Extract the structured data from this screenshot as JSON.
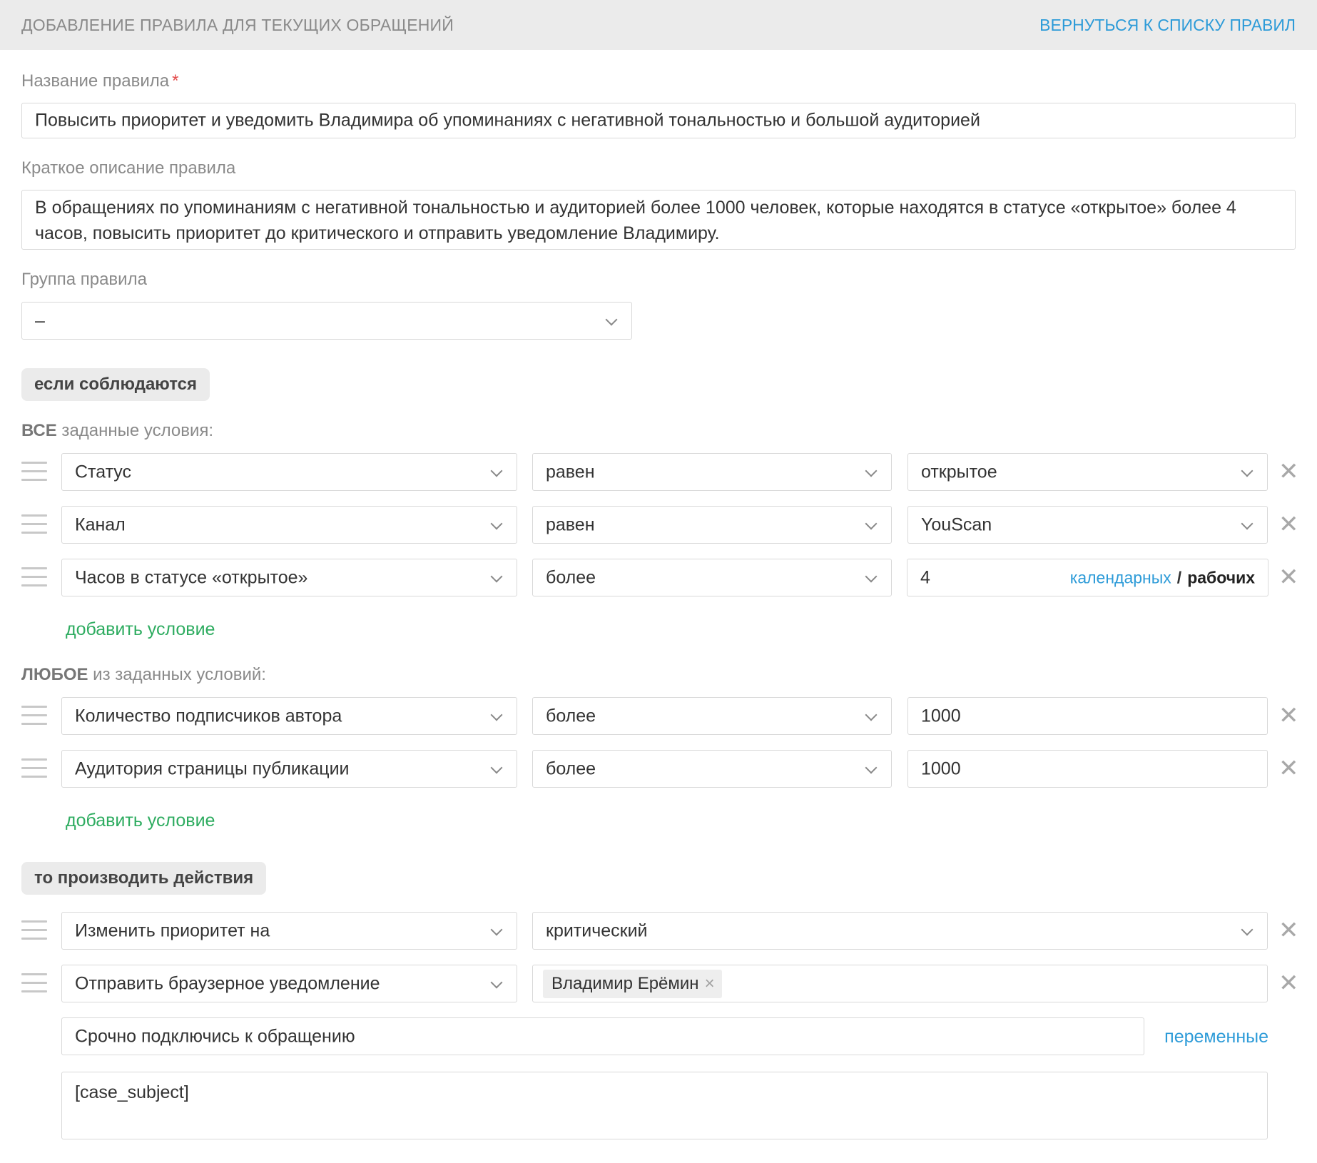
{
  "header": {
    "title": "ДОБАВЛЕНИЕ ПРАВИЛА ДЛЯ ТЕКУЩИХ ОБРАЩЕНИЙ",
    "back_link": "ВЕРНУТЬСЯ К СПИСКУ ПРАВИЛ"
  },
  "form": {
    "name_label": "Название правила",
    "required_mark": "*",
    "name_value": "Повысить приоритет и уведомить Владимира об упоминаниях с негативной тональностью и большой аудиторией",
    "description_label": "Краткое описание правила",
    "description_value": "В обращениях по упоминаниям с негативной тональностью и аудиторией более 1000 человек, которые находятся в статусе «открытое» более 4 часов, повысить приоритет до критического и отправить уведомление Владимиру.",
    "group_label": "Группа правила",
    "group_value": "–"
  },
  "conditions": {
    "section_label": "если соблюдаются",
    "all_label_bold": "ВСЕ",
    "all_label_rest": " заданные условия:",
    "all": [
      {
        "field": "Статус",
        "operator": "равен",
        "value": "открытое"
      },
      {
        "field": "Канал",
        "operator": "равен",
        "value": "YouScan"
      },
      {
        "field": "Часов в статусе «открытое»",
        "operator": "более",
        "value": "4"
      }
    ],
    "hours_units": {
      "calendar": "календарных",
      "separator": "/",
      "working": "рабочих"
    },
    "any_label_bold": "ЛЮБОЕ",
    "any_label_rest": " из заданных условий:",
    "any": [
      {
        "field": "Количество подписчиков автора",
        "operator": "более",
        "value": "1000"
      },
      {
        "field": "Аудитория страницы публикации",
        "operator": "более",
        "value": "1000"
      }
    ],
    "add_condition": "добавить условие",
    "remove_glyph": "✕"
  },
  "actions": {
    "section_label": "то производить действия",
    "items": [
      {
        "action": "Изменить приоритет на",
        "value": "критический"
      },
      {
        "action": "Отправить браузерное уведомление",
        "recipient": "Владимир Ерёмин"
      }
    ],
    "tag_remove_glyph": "×",
    "notification_title": "Срочно подключись к обращению",
    "variables_link": "переменные",
    "notification_body": "[case_subject]"
  },
  "icons": {
    "drag": "drag-handle-icon",
    "chevron": "chevron-down-icon",
    "remove": "close-icon"
  },
  "colors": {
    "accent_link": "#2d9bd8",
    "add_link": "#2eac60",
    "required": "#e34b4b",
    "header_bg": "#ebebeb"
  }
}
